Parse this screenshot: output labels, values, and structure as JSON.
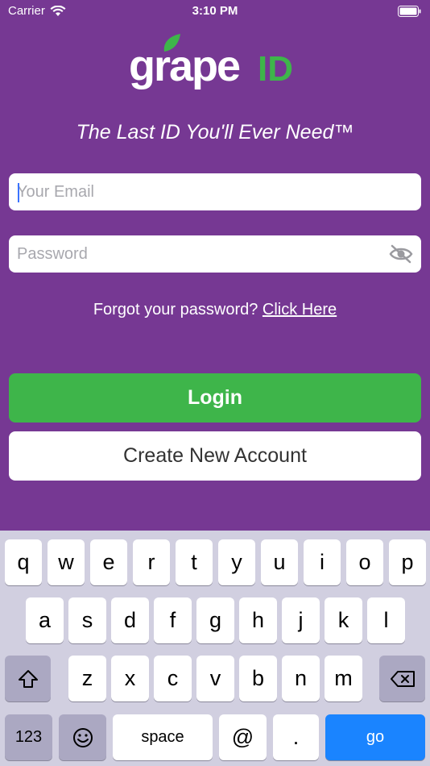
{
  "status_bar": {
    "carrier": "Carrier",
    "time": "3:10 PM"
  },
  "logo": {
    "word": "grape",
    "suffix": "ID"
  },
  "tagline": "The Last ID You'll Ever Need™",
  "email": {
    "placeholder": "Your Email",
    "value": ""
  },
  "password": {
    "placeholder": "Password",
    "value": ""
  },
  "forgot": {
    "text": "Forgot your password? ",
    "link": "Click Here"
  },
  "buttons": {
    "login": "Login",
    "create": "Create New Account"
  },
  "colors": {
    "background": "#763893",
    "login": "#3eb54a",
    "logo_id": "#3eb54a",
    "go_key": "#1a84ff"
  },
  "keyboard": {
    "row1": [
      "q",
      "w",
      "e",
      "r",
      "t",
      "y",
      "u",
      "i",
      "o",
      "p"
    ],
    "row2": [
      "a",
      "s",
      "d",
      "f",
      "g",
      "h",
      "j",
      "k",
      "l"
    ],
    "row3": [
      "z",
      "x",
      "c",
      "v",
      "b",
      "n",
      "m"
    ],
    "numbers": "123",
    "space": "space",
    "at": "@",
    "dot": ".",
    "go": "go"
  }
}
